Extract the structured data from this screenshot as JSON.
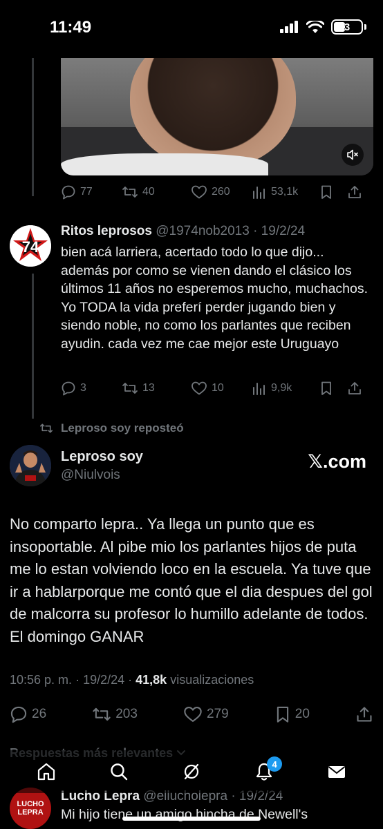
{
  "status_bar": {
    "time": "11:49",
    "battery": "3"
  },
  "prev_tweet": {
    "actions": {
      "replies": "77",
      "reposts": "40",
      "likes": "260",
      "views": "53,1k"
    }
  },
  "tweet2": {
    "name": "Ritos leprosos",
    "handle": "@1974nob2013",
    "date": "· 19/2/24",
    "text": "bien acá larriera, acertado todo lo que dijo... además por como se vienen dando el clásico los últimos 11 años no esperemos mucho, muchachos. Yo TODA la vida preferí perder jugando bien y siendo noble, no como los parlantes que reciben ayudin. cada vez me cae mejor este Uruguayo",
    "actions": {
      "replies": "3",
      "reposts": "13",
      "likes": "10",
      "views": "9,9k"
    }
  },
  "repost_label": "Leproso soy reposteó",
  "main_tweet": {
    "name": "Leproso soy",
    "handle": "@Niulvois",
    "watermark": "𝕏.com",
    "text": "No comparto lepra.. Ya llega un punto que es insoportable. Al pibe mio los parlantes hijos de puta me lo estan volviendo loco en la escuela. Ya tuve que ir a hablarporque me contó que el dia despues del gol de malcorra su profesor lo humillo adelante de todos. El domingo GANAR",
    "time": "10:56 p. m.",
    "date": "· 19/2/24 ·",
    "views_count": "41,8k",
    "views_label": "visualizaciones",
    "actions": {
      "replies": "26",
      "reposts": "203",
      "likes": "279",
      "bookmarks": "20"
    }
  },
  "replies_heading": "Respuestas más relevantes",
  "tab_bar": {
    "notification_count": "4"
  },
  "reply": {
    "name": "Lucho Lepra",
    "handle": "@ellucholepra",
    "date": "· 19/2/24",
    "text": "Mi hijo tiene un amigo hincha de Newell's",
    "avatar_text": "LUCHO LEPRA"
  },
  "colors": {
    "background": "#000000",
    "text": "#e7e9ea",
    "muted": "#71767b",
    "accent": "#1d9bf0"
  }
}
